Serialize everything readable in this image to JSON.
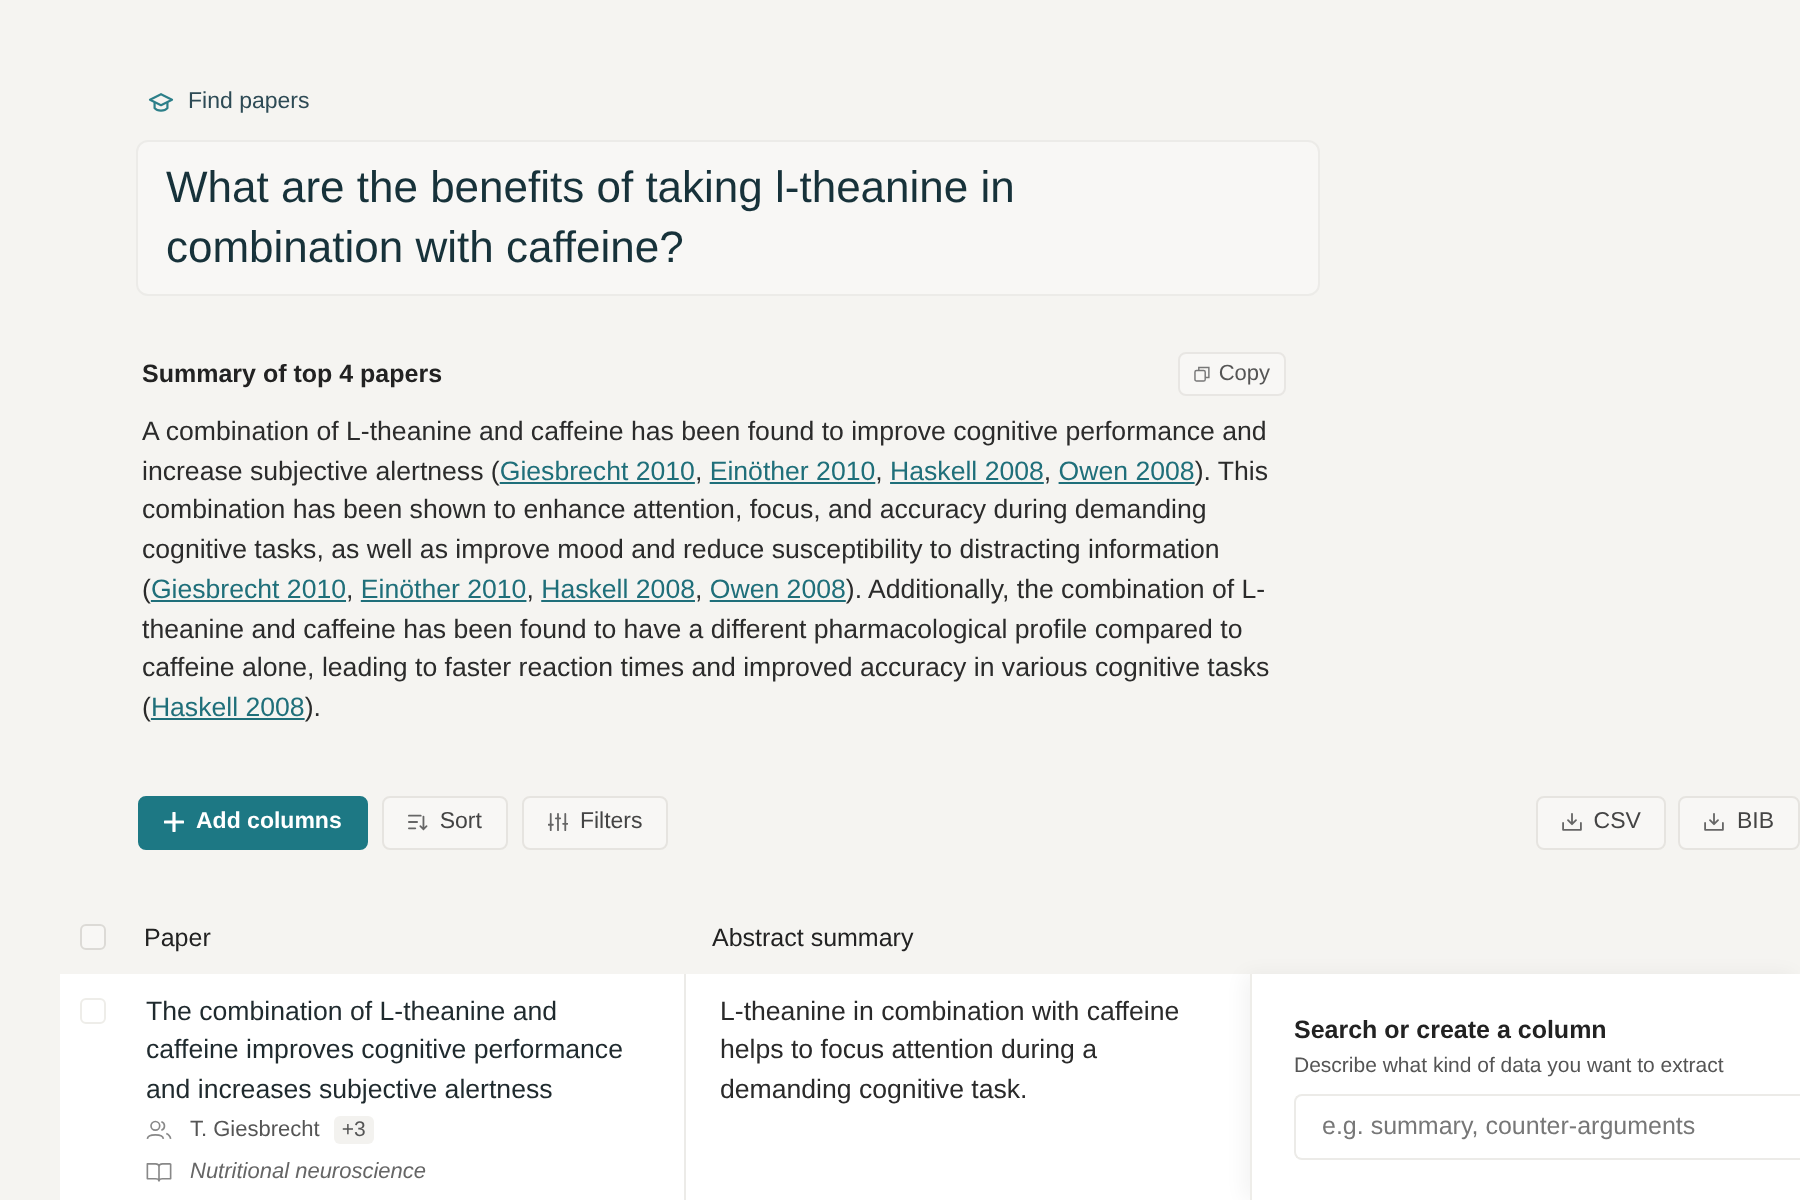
{
  "breadcrumb": {
    "label": "Find papers"
  },
  "query": {
    "text": "What are the benefits of taking l-theanine in combination with caffeine?"
  },
  "summary": {
    "title": "Summary of top 4 papers",
    "copy_button": "Copy",
    "segments": [
      {
        "kind": "text",
        "text": "A combination of L-theanine and caffeine has been found to improve cognitive performance and increase subjective alertness ("
      },
      {
        "kind": "link",
        "text": "Giesbrecht 2010"
      },
      {
        "kind": "text",
        "text": ", "
      },
      {
        "kind": "link",
        "text": "Einöther 2010"
      },
      {
        "kind": "text",
        "text": ", "
      },
      {
        "kind": "link",
        "text": "Haskell 2008"
      },
      {
        "kind": "text",
        "text": ", "
      },
      {
        "kind": "link",
        "text": "Owen 2008"
      },
      {
        "kind": "text",
        "text": "). This combination has been shown to enhance attention, focus, and accuracy during demanding cognitive tasks, as well as improve mood and reduce susceptibility to distracting information ("
      },
      {
        "kind": "link",
        "text": "Giesbrecht 2010"
      },
      {
        "kind": "text",
        "text": ", "
      },
      {
        "kind": "link",
        "text": "Einöther 2010"
      },
      {
        "kind": "text",
        "text": ", "
      },
      {
        "kind": "link",
        "text": "Haskell 2008"
      },
      {
        "kind": "text",
        "text": ", "
      },
      {
        "kind": "link",
        "text": "Owen 2008"
      },
      {
        "kind": "text",
        "text": "). Additionally, the combination of L-theanine and caffeine has been found to have a different pharmacological profile compared to caffeine alone, leading to faster reaction times and improved accuracy in various cognitive tasks ("
      },
      {
        "kind": "link",
        "text": "Haskell 2008"
      },
      {
        "kind": "text",
        "text": ")."
      }
    ]
  },
  "toolbar": {
    "left": [
      {
        "kind": "add",
        "label": "Add columns"
      },
      {
        "kind": "sort",
        "label": "Sort"
      },
      {
        "kind": "filter",
        "label": "Filters"
      }
    ],
    "right": [
      {
        "kind": "download",
        "label": "CSV"
      },
      {
        "kind": "download",
        "label": "BIB"
      }
    ]
  },
  "table": {
    "select_all": {
      "checked": false
    },
    "columns": [
      "Paper",
      "Abstract summary"
    ],
    "rows": [
      {
        "checked": false,
        "title": "The combination of L-theanine and caffeine improves cognitive performance and increases subjective alertness",
        "author": "T. Giesbrecht",
        "more_authors": "+3",
        "journal": "Nutritional neuroscience",
        "abstract_summary": "L-theanine in combination with caffeine helps to focus attention during a demanding cognitive task."
      }
    ]
  },
  "column_popover": {
    "title": "Search or create a column",
    "description": "Describe what kind of data you want to extract",
    "placeholder": "e.g. summary, counter-arguments"
  }
}
